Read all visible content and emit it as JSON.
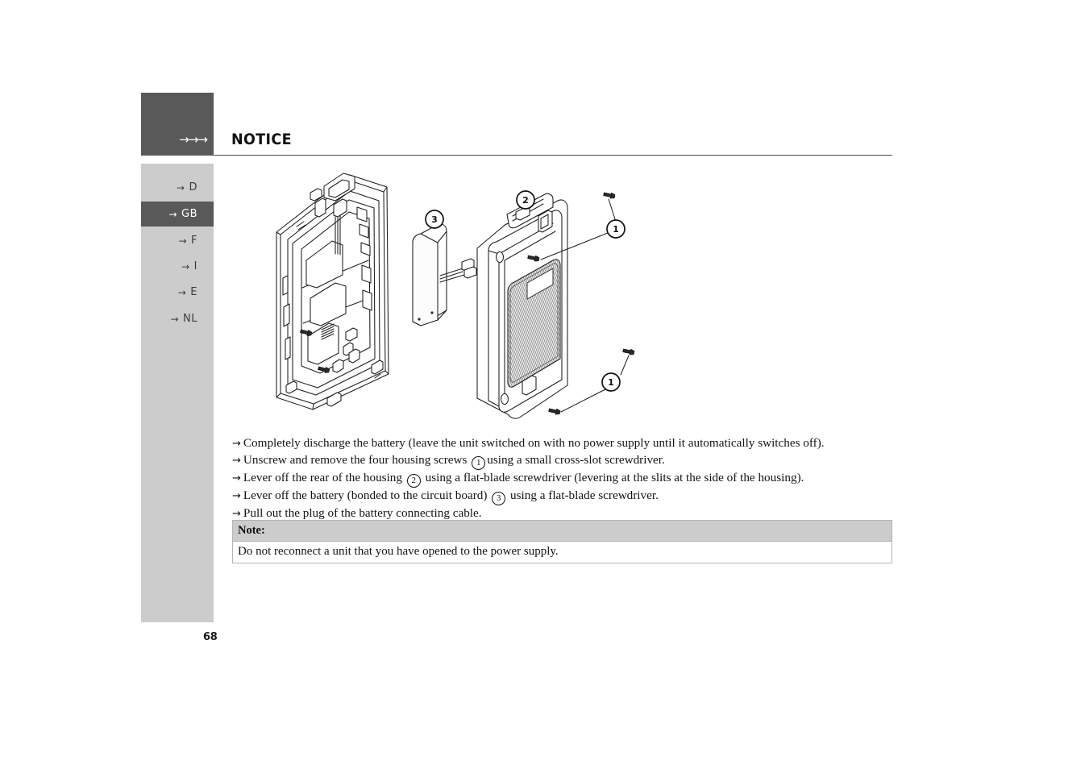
{
  "document": {
    "page_number": "68",
    "header_title": "NOTICE",
    "header_arrows": "→→→"
  },
  "sidebar": {
    "arrow_glyph": "→",
    "items": [
      {
        "label": "D",
        "active": false
      },
      {
        "label": "GB",
        "active": true
      },
      {
        "label": "F",
        "active": false
      },
      {
        "label": "I",
        "active": false
      },
      {
        "label": "E",
        "active": false
      },
      {
        "label": "NL",
        "active": false
      }
    ]
  },
  "figure": {
    "caption_labels": [
      "1",
      "2",
      "3"
    ],
    "description": "Exploded view of a cordless telephone base unit: front housing with circuit board, battery pack, rear housing cover and four housing screws",
    "callouts": [
      {
        "number": "1",
        "target": "housing screw (upper right)"
      },
      {
        "number": "1",
        "target": "housing screw (lower right)"
      },
      {
        "number": "2",
        "target": "rear of the housing"
      },
      {
        "number": "3",
        "target": "battery bonded to circuit board"
      }
    ]
  },
  "instructions": {
    "arrow_glyph": "→",
    "steps": [
      {
        "pre": "Completely discharge the battery (leave the unit switched on with no power supply until it automatically switches off).",
        "ref": "",
        "post": ""
      },
      {
        "pre": "Unscrew and remove the four housing screws",
        "ref": "1",
        "post": "using a small cross-slot screwdriver."
      },
      {
        "pre": "Lever off the rear of the housing",
        "ref": "2",
        "post": " using a flat-blade screwdriver (levering at the slits at the side of the housing)."
      },
      {
        "pre": "Lever off the battery (bonded to the circuit board)",
        "ref": "3",
        "post": " using a flat-blade screwdriver."
      },
      {
        "pre": "Pull out the plug of the battery connecting cable.",
        "ref": "",
        "post": ""
      }
    ]
  },
  "note": {
    "title": "Note:",
    "text": "Do not reconnect a unit that you have opened to the power supply."
  },
  "colors": {
    "sidebar_active": "#595959",
    "sidebar_background": "#cccccc",
    "note_header": "#cccccc",
    "rule": "#4a4a4a",
    "text": "#141414"
  }
}
